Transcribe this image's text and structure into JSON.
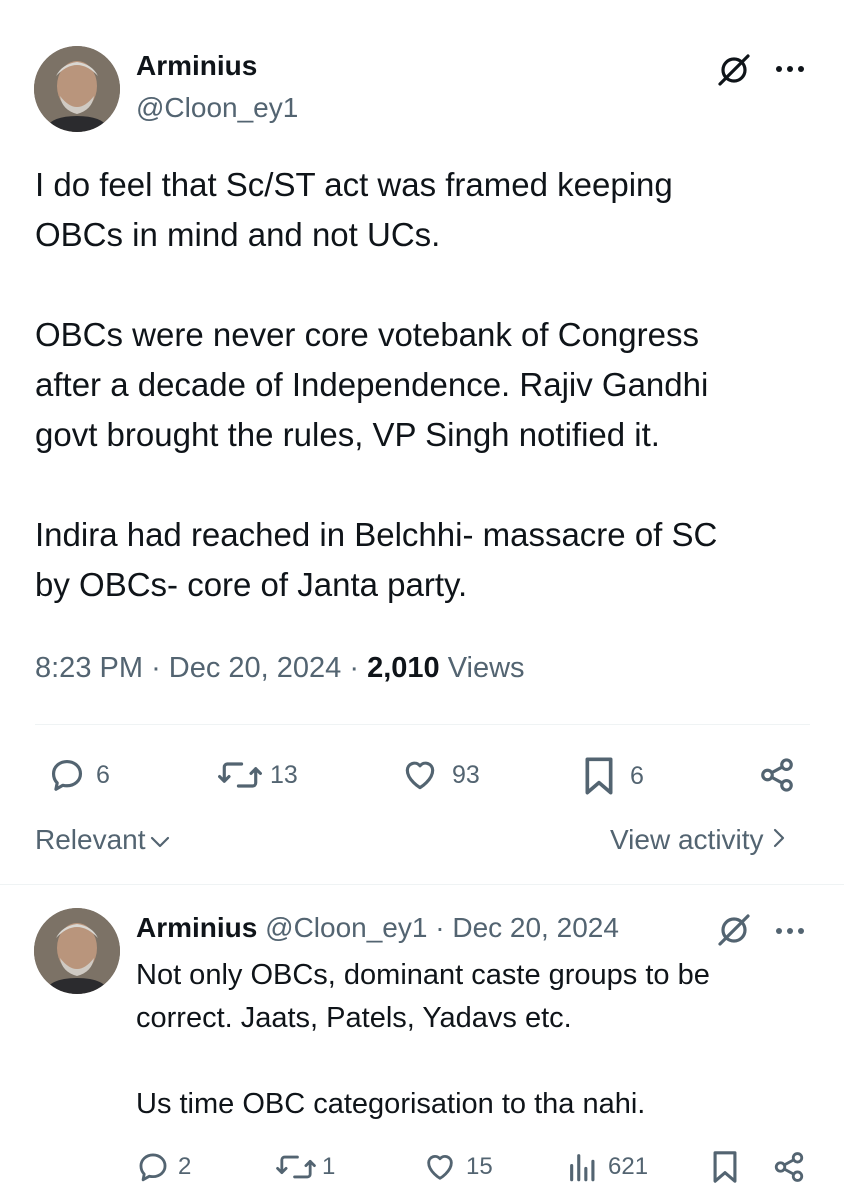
{
  "post": {
    "author_name": "Arminius",
    "author_handle": "@Cloon_ey1",
    "paragraphs": [
      [
        "I do feel that Sc/ST act was framed keeping",
        "OBCs in mind and not UCs."
      ],
      [
        "OBCs were never core votebank of Congress",
        "after a decade of Independence. Rajiv Gandhi",
        "govt brought the rules, VP Singh notified it."
      ],
      [
        "Indira had reached in Belchhi- massacre of SC",
        "by OBCs- core of Janta party."
      ]
    ],
    "time": "8:23 PM",
    "date": "Dec 20, 2024",
    "views_count": "2,010",
    "views_label": "Views",
    "actions": {
      "replies": "6",
      "reposts": "13",
      "likes": "93",
      "bookmarks": "6"
    }
  },
  "filter": {
    "sort_label": "Relevant",
    "activity_label": "View activity"
  },
  "reply": {
    "author_name": "Arminius",
    "author_handle": "@Cloon_ey1",
    "date": "Dec 20, 2024",
    "paragraphs": [
      [
        "Not only OBCs, dominant caste groups to be",
        "correct. Jaats, Patels, Yadavs etc."
      ],
      [
        "Us time OBC categorisation to tha nahi."
      ]
    ],
    "actions": {
      "replies": "2",
      "reposts": "1",
      "likes": "15",
      "views": "621"
    }
  },
  "icons": {
    "grok": "slashed-circle-icon",
    "more": "more-dots-icon",
    "reply": "speech-bubble-icon",
    "repost": "repost-arrows-icon",
    "like": "heart-icon",
    "bookmark": "bookmark-icon",
    "share": "share-icon",
    "views": "bar-chart-icon"
  },
  "colors": {
    "text": "#0f1419",
    "secondary": "#536471",
    "divider": "#eff3f4"
  }
}
